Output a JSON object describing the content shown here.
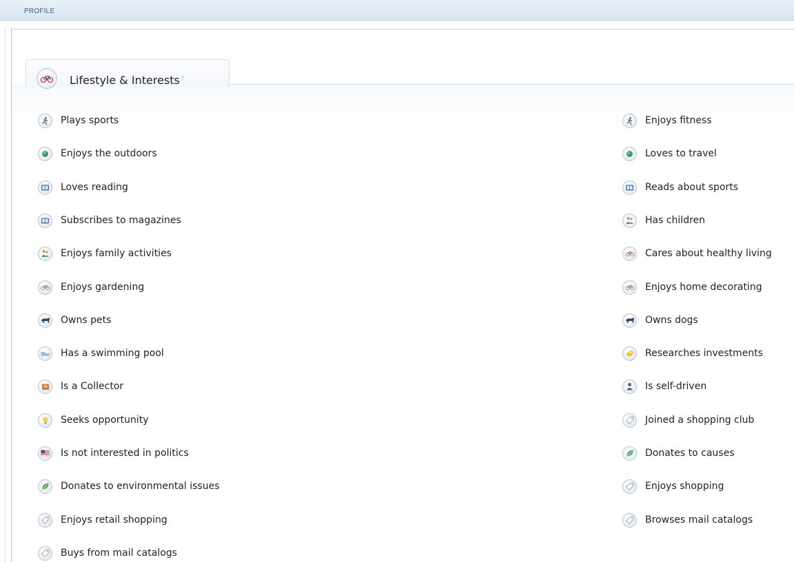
{
  "header": {
    "title": "PROFILE"
  },
  "section": {
    "tab_label": "Lifestyle & Interests",
    "tab_marker": "†",
    "tab_icon": "bicycle-icon"
  },
  "left_column": [
    {
      "label": "Plays sports",
      "icon": "runner-icon"
    },
    {
      "label": "Enjoys the outdoors",
      "icon": "globe-icon"
    },
    {
      "label": "Loves reading",
      "icon": "book-icon"
    },
    {
      "label": "Subscribes to magazines",
      "icon": "book-icon"
    },
    {
      "label": "Enjoys family activities",
      "icon": "family-icon"
    },
    {
      "label": "Enjoys gardening",
      "icon": "bicycle-icon"
    },
    {
      "label": "Owns pets",
      "icon": "animal-icon"
    },
    {
      "label": "Has a swimming pool",
      "icon": "wave-icon"
    },
    {
      "label": "Is a Collector",
      "icon": "box-icon"
    },
    {
      "label": "Seeks opportunity",
      "icon": "lightbulb-icon"
    },
    {
      "label": "Is not interested in politics",
      "icon": "flag-icon"
    },
    {
      "label": "Donates to environmental issues",
      "icon": "leaf-icon"
    },
    {
      "label": "Enjoys retail shopping",
      "icon": "tag-icon"
    },
    {
      "label": "Buys from mail catalogs",
      "icon": "tag-icon"
    }
  ],
  "right_column": [
    {
      "label": "Enjoys fitness",
      "icon": "runner-icon"
    },
    {
      "label": "Loves to travel",
      "icon": "globe-icon"
    },
    {
      "label": "Reads about sports",
      "icon": "book-icon"
    },
    {
      "label": "Has children",
      "icon": "family-icon"
    },
    {
      "label": "Cares about healthy living",
      "icon": "bicycle-icon"
    },
    {
      "label": "Enjoys home decorating",
      "icon": "bicycle-icon"
    },
    {
      "label": "Owns dogs",
      "icon": "animal-icon"
    },
    {
      "label": "Researches investments",
      "icon": "coins-icon"
    },
    {
      "label": "Is self-driven",
      "icon": "person-icon"
    },
    {
      "label": "Joined a shopping club",
      "icon": "tag-icon"
    },
    {
      "label": "Donates to causes",
      "icon": "leaf-icon"
    },
    {
      "label": "Enjoys shopping",
      "icon": "tag-icon"
    },
    {
      "label": "Browses mail catalogs",
      "icon": "tag-icon"
    }
  ]
}
